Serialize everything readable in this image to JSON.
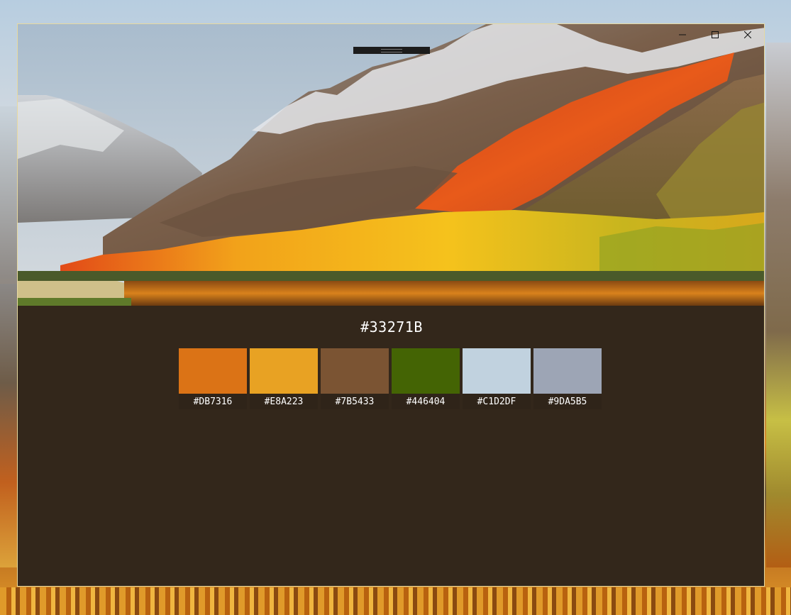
{
  "window": {
    "background_color": "#33271B",
    "controls": {
      "minimize_icon": "minimize-icon",
      "maximize_icon": "maximize-icon",
      "close_icon": "close-icon"
    }
  },
  "main_color": {
    "hex": "#33271B"
  },
  "palette": [
    {
      "hex": "#DB7316",
      "color": "#DB7316"
    },
    {
      "hex": "#E8A223",
      "color": "#E8A223"
    },
    {
      "hex": "#7B5433",
      "color": "#7B5433"
    },
    {
      "hex": "#446404",
      "color": "#446404"
    },
    {
      "hex": "#C1D2DF",
      "color": "#C1D2DF"
    },
    {
      "hex": "#9DA5B5",
      "color": "#9DA5B5"
    }
  ]
}
